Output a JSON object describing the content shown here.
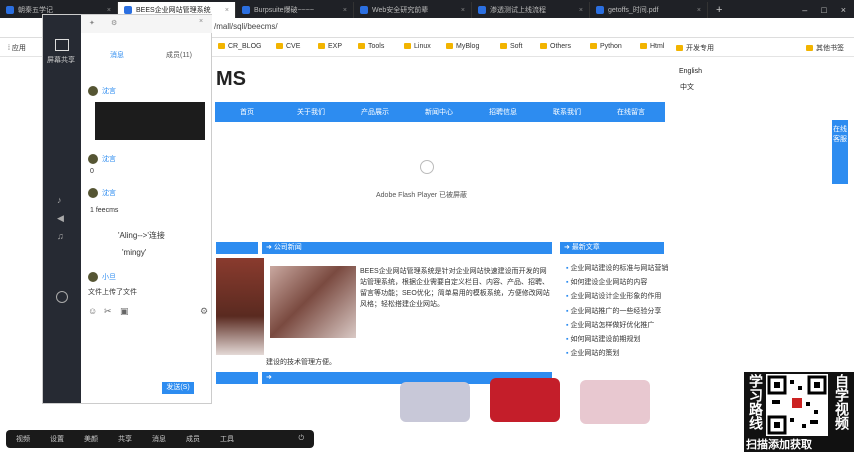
{
  "tabs": [
    {
      "label": "朝秦五学记"
    },
    {
      "label": "BEES企业网站管理系统",
      "active": true
    },
    {
      "label": "Burpsuite爆破~~~~"
    },
    {
      "label": "Web安全研究前辈"
    },
    {
      "label": "渗透测试上线流程"
    },
    {
      "label": "getoffs_时间.pdf"
    }
  ],
  "url": "/mall/sqli/beecms/",
  "bookmarks": [
    "应用",
    "CR_BLOG",
    "CVE",
    "EXP",
    "Tools",
    "Linux",
    "MyBlog",
    "Soft",
    "Others",
    "Python",
    "Html",
    "开发专用",
    "其他书签"
  ],
  "site": {
    "logo": "MS",
    "lang_en": "English",
    "lang_cn": "中文",
    "nav": [
      "首页",
      "关于我们",
      "产品展示",
      "新闻中心",
      "招聘信息",
      "联系我们",
      "在线留言"
    ],
    "flash_text": "Adobe Flash Player 已被屏蔽",
    "news_title": "公司新闻",
    "links_title": "最新文章",
    "article": "BEES企业网站管理系统是针对企业网站快速建设而开发的网站管理系统，根据企业需要自定义栏目、内容、产品、招聘、留言等功能；SEO优化；简单易用的模板系统，方便修改网站风格；轻松搭建企业网站。",
    "article_tail": "建设的技术管理方便。",
    "links": [
      "企业网站建设的标准与网站营销",
      "如何建设企业网站的内容",
      "企业网站设计企业形象的作用",
      "企业网站推广的一些经验分享",
      "企业网站怎样做好优化推广",
      "如何网站建设前期规划",
      "企业网站的策划"
    ],
    "side_btn": "在线客服"
  },
  "chat": {
    "tabs": [
      "消息",
      "成员(11)"
    ],
    "messages": [
      {
        "user": "沈言",
        "text": ""
      },
      {
        "user": "沈言",
        "text": "0"
      },
      {
        "user": "沈言",
        "text": "1 feecms"
      },
      {
        "user": "",
        "text": "'Aling-->'连接"
      },
      {
        "user": "",
        "text": "'mingy'"
      },
      {
        "user": "小旦",
        "text": "文件上传了文件"
      }
    ],
    "send": "发送(S)",
    "sidebar_label": "屏幕共享"
  },
  "taskbar": [
    "视频",
    "设置",
    "美颜",
    "共享",
    "消息",
    "成员",
    "工具"
  ],
  "overlay": {
    "left": "学习路线",
    "right": "自学视频",
    "caption": "扫描添加获取"
  }
}
